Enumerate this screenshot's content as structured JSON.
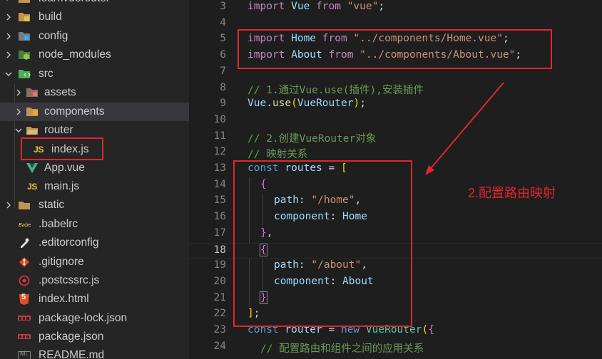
{
  "explorer": {
    "root_label": "learnvuerouter",
    "items": [
      {
        "label": "build",
        "icon": "folder-build-icon"
      },
      {
        "label": "config",
        "icon": "folder-config-icon"
      },
      {
        "label": "node_modules",
        "icon": "folder-node-icon"
      },
      {
        "label": "src",
        "icon": "folder-src-icon"
      },
      {
        "label": "assets",
        "icon": "folder-assets-icon"
      },
      {
        "label": "components",
        "icon": "folder-components-icon"
      },
      {
        "label": "router",
        "icon": "folder-open-icon"
      },
      {
        "label": "index.js",
        "icon": "js-file-icon"
      },
      {
        "label": "App.vue",
        "icon": "vue-file-icon"
      },
      {
        "label": "main.js",
        "icon": "js-file-icon"
      },
      {
        "label": "static",
        "icon": "folder-icon"
      },
      {
        "label": ".babelrc",
        "icon": "babel-file-icon"
      },
      {
        "label": ".editorconfig",
        "icon": "editorconfig-file-icon"
      },
      {
        "label": ".gitignore",
        "icon": "git-file-icon"
      },
      {
        "label": ".postcssrc.js",
        "icon": "postcss-file-icon"
      },
      {
        "label": "index.html",
        "icon": "html-file-icon"
      },
      {
        "label": "package-lock.json",
        "icon": "npm-file-icon"
      },
      {
        "label": "package.json",
        "icon": "npm-file-icon"
      },
      {
        "label": "README.md",
        "icon": "markdown-file-icon"
      }
    ],
    "js_glyph": "JS",
    "html_glyph": "5",
    "md_glyph": "M↓"
  },
  "editor": {
    "line_numbers": [
      "3",
      "4",
      "5",
      "6",
      "7",
      "8",
      "9",
      "10",
      "11",
      "12",
      "13",
      "14",
      "15",
      "16",
      "17",
      "18",
      "19",
      "20",
      "21",
      "22",
      "23",
      "24"
    ],
    "active_line": "18",
    "code": {
      "l3": {
        "kw": "import",
        "name": " Vue ",
        "from": "from",
        "str": " \"vue\"",
        "end": ";"
      },
      "l5": {
        "kw": "import",
        "name": " Home ",
        "from": "from",
        "str": " \"../components/Home.vue\"",
        "end": ";"
      },
      "l6": {
        "kw": "import",
        "name": " About ",
        "from": "from",
        "str": " \"../components/About.vue\"",
        "end": ";"
      },
      "l8": {
        "comment": "// 1.通过Vue.use(插件),安装插件"
      },
      "l9": {
        "obj": "Vue",
        "dot": ".",
        "fn": "use",
        "open": "(",
        "arg": "VueRouter",
        "close": ")",
        "end": ";"
      },
      "l11": {
        "comment": "// 2.创建VueRouter对象"
      },
      "l12": {
        "comment": "// 映射关系"
      },
      "l13": {
        "kw": "const",
        "name": " routes ",
        "eq": "= ",
        "br": "["
      },
      "l14": {
        "br": "{"
      },
      "l15": {
        "key": "path",
        "colon": ": ",
        "str": "\"/home\"",
        "comma": ","
      },
      "l16": {
        "key": "component",
        "colon": ": ",
        "val": "Home"
      },
      "l17": {
        "br": "}",
        "comma": ","
      },
      "l18": {
        "br": "{"
      },
      "l19": {
        "key": "path",
        "colon": ": ",
        "str": "\"/about\"",
        "comma": ","
      },
      "l20": {
        "key": "component",
        "colon": ": ",
        "val": "About"
      },
      "l21": {
        "br": "}"
      },
      "l22": {
        "br": "]",
        "end": ";"
      },
      "l23": {
        "kw": "const",
        "name": " router ",
        "eq": "= ",
        "new": "new",
        "cls": " VueRouter",
        "open": "(",
        "br": "{"
      },
      "l24": {
        "comment": "// 配置路由和组件之间的应用关系"
      }
    }
  },
  "annotation": {
    "label": "2.配置路由映射",
    "color": "#e1262d"
  },
  "colors": {
    "keyword": "#569cd6",
    "string": "#ce9178",
    "comment": "#6a9955",
    "variable": "#9cdcfe",
    "class": "#4ec9b0"
  }
}
